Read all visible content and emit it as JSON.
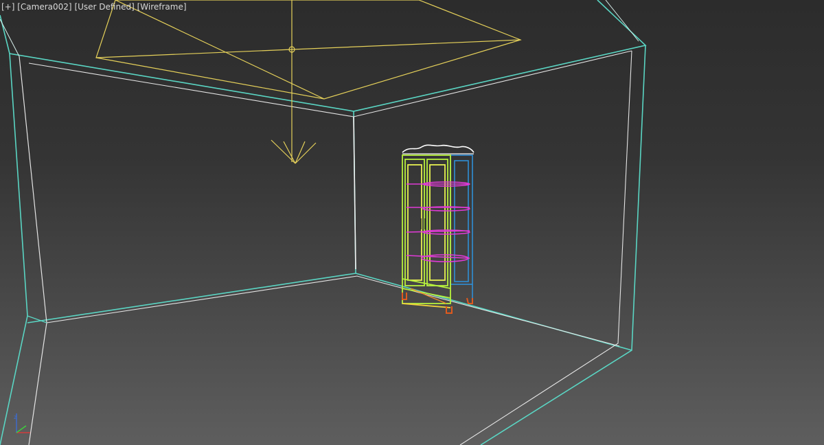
{
  "viewport": {
    "menu_label": "[+]",
    "camera_label": "[Camera002]",
    "shading_preset_label": "[User Defined]",
    "display_mode_label": "[Wireframe]"
  },
  "scene": {
    "objects": [
      "room-wireframe",
      "area-light",
      "display-cabinet"
    ],
    "colors": {
      "room": "#5ad6c4",
      "room_inner": "#ffffff",
      "light": "#e6d15a",
      "cabinet_frame": "#b8f23c",
      "cabinet_side": "#2f8fd6",
      "cabinet_shelves": "#e03ad6",
      "cabinet_feet": "#e05a1e",
      "cabinet_crown": "#ffffff"
    }
  },
  "axis_gizmo": {
    "icon": "axis-tripod-icon",
    "colors": {
      "x": "#d23c3c",
      "y": "#3cd23c",
      "z": "#3c6cd2"
    }
  }
}
